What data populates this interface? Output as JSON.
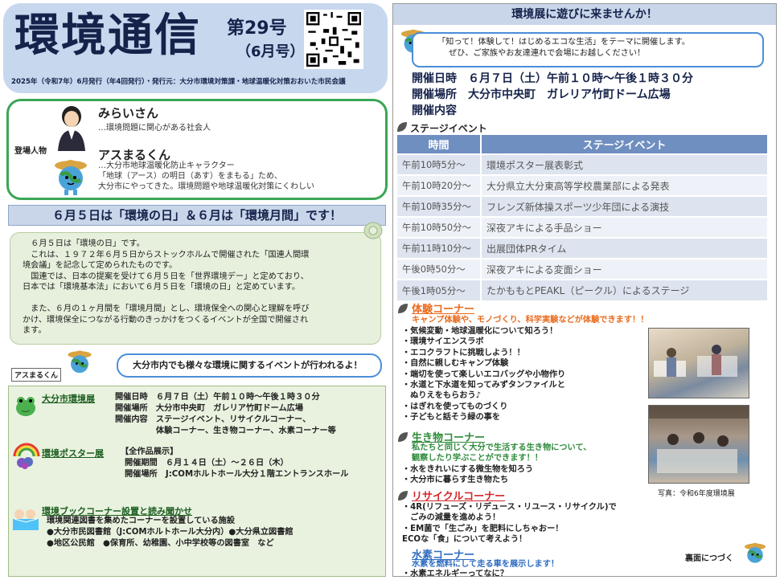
{
  "header": {
    "title": "環境通信",
    "issue": "第29号",
    "month": "（6月号）",
    "pub_info": "2025年（令和7年）6月発行（年4回発行）・発行元：大分市環境対策課・地球温暖化対策おおいた市民会議"
  },
  "characters": {
    "label": "登場人物",
    "mirai": {
      "name": "みらいさん",
      "desc": "…環境問題に関心がある社会人"
    },
    "asumaru": {
      "name": "アスまるくん",
      "desc": [
        "…大分市地球温暖化防止キャラクター",
        "「地球（アース）の明日（あす）をまもる」ため、",
        "大分市にやってきた。環境問題や地球温暖化対策にくわしい"
      ]
    }
  },
  "left": {
    "banner": "６月５日は「環境の日」＆６月は「環境月間」です！",
    "paragraphs": [
      "　６月５日は「環境の日」です。",
      "　これは、１９７２年６月５日からストックホルムで開催された「国連人間環",
      "境会議」を記念して定められたものです。",
      "　国連では、日本の提案を受けて６月５日を「世界環境デー」と定めており、",
      "日本では「環境基本法」において６月５日を「環境の日」と定めています。",
      "",
      "　また、６月の１ヶ月間を「環境月間」とし、環境保全への関心と理解を呼び",
      "かけ、環境保全につながる行動のきっかけをつくるイベントが全国で開催され",
      "ます。"
    ],
    "asu_tag": "アスまるくん",
    "bubble": "大分市内でも様々な環境に関するイベントが行われるよ！",
    "events": {
      "expo": {
        "title": "大分市環境展",
        "lines": [
          "開催日時　６月７日（土）午前１０時～午後１時３０分",
          "開催場所　大分市中央町　ガレリア竹町ドーム広場",
          "開催内容　ステージイベント、リサイクルコーナー、",
          "　　　　　体験コーナー、生き物コーナー、水素コーナー等"
        ]
      },
      "poster": {
        "title": "環境ポスター展",
        "head": "【全作品展示】",
        "lines": [
          "開催期間　６月１４日（土）～２６日（木）",
          "開催場所　J:COMホルトホール大分１階エントランスホール"
        ]
      },
      "book": {
        "title": "環境ブックコーナー設置と読み聞かせ",
        "lines": [
          "環境関連図書を集めたコーナーを設置している施設",
          "●大分市民図書館（J:COMホルトホール大分内）●大分県立図書館",
          "●地区公民館　●保育所、幼稚園、小中学校等の図書室　など"
        ]
      }
    }
  },
  "right": {
    "banner": "環境展に遊びに来ませんか！",
    "callout": [
      "「知って！体験して！はじめるエコな生活」をテーマに開催します。",
      "ぜひ、ご家族やお友達連れで会場にお越しください！"
    ],
    "info": [
      "開催日時　６月７日（土）午前１０時～午後１時３０分",
      "開催場所　大分市中央町　ガレリア竹町ドーム広場",
      "開催内容"
    ],
    "stage_label": "ステージイベント",
    "stage_headers": [
      "時間",
      "ステージイベント"
    ],
    "stage_rows": [
      [
        "午前10時5分～",
        "環境ポスター展表彰式"
      ],
      [
        "午前10時20分～",
        "大分県立大分東高等学校農業部による発表"
      ],
      [
        "午前10時35分～",
        "フレンズ新体操スポーツ少年団による演技"
      ],
      [
        "午前10時50分～",
        "深夜アキによる手品ショー"
      ],
      [
        "午前11時10分～",
        "出展団体PRタイム"
      ],
      [
        "午後0時50分～",
        "深夜アキによる変面ショー"
      ],
      [
        "午後1時05分～",
        "たかももとPEAKL（ピークル）によるステージ"
      ]
    ],
    "taiken": {
      "title": "体験コーナー",
      "sub": "キャンプ体験や、モノづくり、科学実験などが体験できます！！",
      "items": [
        "・気候変動・地球温暖化について知ろう！",
        "・環境サイエンスラボ",
        "・エコクラフトに挑戦しよう！！",
        "・自然に親しむキャンプ体験",
        "・端切を使って楽しいエコバッグや小物作り",
        "・水道と下水道を知ってみずタンファイルと",
        "　ぬりえをもらおう♪",
        "・はぎれを使ってものづくり",
        "・子どもと話そう緑の事を"
      ]
    },
    "ikimono": {
      "title": "生き物コーナー",
      "sub": [
        "私たちと同じく大分で生活する生き物について、",
        "観察したり学ぶことができます！！"
      ],
      "items": [
        "・水をきれいにする微生物を知ろう",
        "・大分市に暮らす生き物たち"
      ]
    },
    "recycle": {
      "title": "リサイクルコーナー",
      "items": [
        "・4R(リフューズ・リデュース・リユース・リサイクル)で",
        "　ごみの減量を進めよう！",
        "・EM菌で「生ごみ」を肥料にしちゃおー！",
        "ECOな「食」について考えよう！"
      ]
    },
    "suiso": {
      "title": "水素コーナー",
      "sub": "水素を燃料にして走る車を展示します！",
      "items": [
        "・水素エネルギーってなに？"
      ]
    },
    "caption": "写真：令和6年度環境展",
    "next": "裏面につづく"
  },
  "colors": {
    "header_bg": "#c7d7ee",
    "banner_bg": "#c9d6ea",
    "green_border": "#3aa655",
    "orange": "#e86a1c",
    "red": "#d3262a",
    "green": "#2e8b3a",
    "blue": "#2d6cc0"
  }
}
